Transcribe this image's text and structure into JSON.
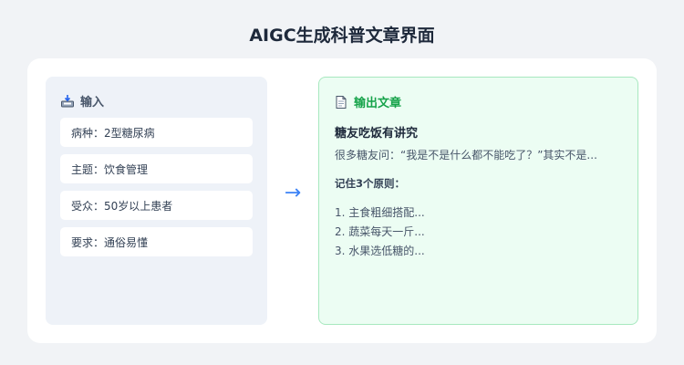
{
  "title": "AIGC生成科普文章界面",
  "input_panel": {
    "icon": "inbox-tray-icon",
    "label": "输入",
    "fields": [
      "病种：2型糖尿病",
      "主题：饮食管理",
      "受众：50岁以上患者",
      "要求：通俗易懂"
    ]
  },
  "arrow": "→",
  "output_panel": {
    "icon": "page-document-icon",
    "label": "输出文章",
    "article": {
      "title": "糖友吃饭有讲究",
      "intro": "很多糖友问：“我是不是什么都不能吃了？”其实不是...",
      "principles_heading": "记住3个原则：",
      "principles": [
        "1. 主食粗细搭配...",
        "2. 蔬菜每天一斤...",
        "3. 水果选低糖的..."
      ]
    }
  },
  "colors": {
    "output_accent": "#16a34a",
    "arrow": "#3b82f6",
    "input_panel_bg": "#eef2f8",
    "output_panel_bg": "#ecfdf3"
  }
}
